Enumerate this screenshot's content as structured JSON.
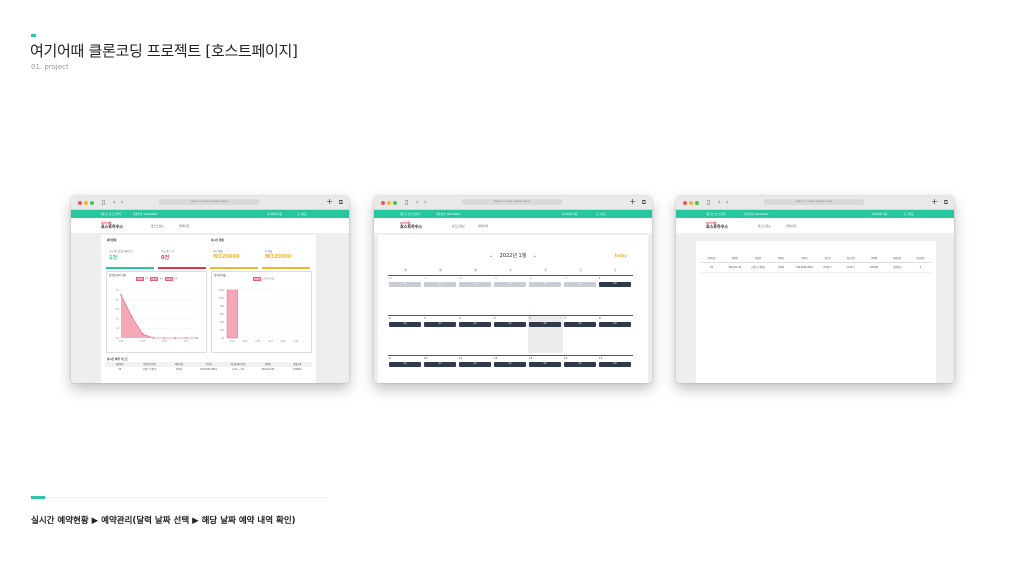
{
  "page": {
    "title": "여기어때 클론코딩 프로젝트 [호스트페이지]",
    "subtitle": "01. project",
    "caption": "실시간 예약현황 ▶ 예약관리(달력 날짜 선택 ▶ 해당 날짜 예약 내역 확인)"
  },
  "colors": {
    "accent": "#2ec4a6",
    "header_green": "#26c69f",
    "brand_red": "#e0344a",
    "today": "#f0b82e",
    "cal_button": "#2f3b4c"
  },
  "browser": {
    "back_icon": "chevron-left-icon",
    "forward_icon": "chevron-right-icon",
    "new_tab_label": "+",
    "url_placeholder": "Search or enter website name"
  },
  "site": {
    "logo_small": "여기어때",
    "logo_main": "호스트하우스",
    "header_left_1": "제트호 호스트센터",
    "header_left_2": "대표번호 1644-6007",
    "header_right_1": "여기어때 이용",
    "header_right_2": "로그아웃",
    "nav": [
      "호스트정보",
      "예약관리"
    ]
  },
  "dashboard": {
    "section_realtime": "예약현황",
    "section_sales": "실시간 매출",
    "cards": [
      {
        "label": "오늘 체크인할 예약건수",
        "value": "1건",
        "color": "#26c69f"
      },
      {
        "label": "오늘 취소 건",
        "value": "0건",
        "color": "#e0344a"
      },
      {
        "label": "지난 매출",
        "value": "₩120000",
        "color": "#f0b82e"
      },
      {
        "label": "총 매출",
        "value": "₩120000",
        "color": "#f0b82e"
      }
    ],
    "chart1_title": "일자별 예약 현황",
    "chart1_legend": [
      "예약",
      "취소",
      "전체"
    ],
    "chart2_title": "일자별 매출",
    "chart2_legend": "일자별 총 매출",
    "table_title": "실시간 예약 리스트",
    "table_headers": [
      "예약번호",
      "객실/투숙인원",
      "예약자명",
      "연락처",
      "체크인/체크아웃",
      "결제일",
      "결제금액"
    ],
    "table_row": [
      "35",
      "스위트 2 명(2)",
      "이박원",
      "010-6536-3061",
      "1/11 ~ 1/4",
      "2022-01-06",
      "120000"
    ]
  },
  "calendar": {
    "month": "2022년 1월",
    "prev_arrow": "◂",
    "next_arrow": "▸",
    "today_label": "Today",
    "weekdays": [
      "일",
      "월",
      "화",
      "수",
      "목",
      "금",
      "토"
    ],
    "button_label": "예약",
    "weeks": [
      [
        "26",
        "27",
        "28",
        "29",
        "30",
        "31",
        "1"
      ],
      [
        "2",
        "3",
        "4",
        "5",
        "6",
        "7",
        "8"
      ],
      [
        "9",
        "10",
        "11",
        "12",
        "13",
        "14",
        "15"
      ]
    ]
  },
  "reservation_detail": {
    "headers": [
      "예약번호",
      "예약일",
      "객실명",
      "예약자",
      "연락처",
      "체크인",
      "체크아웃",
      "결제액",
      "예약확인",
      "입금확인"
    ],
    "row": [
      "35",
      "2022-01-06",
      "스위트 2 명(2)",
      "이박원",
      "010-6536-3061",
      "15:00 ↑",
      "11:00 ↑",
      "120000",
      "확인완료",
      "0"
    ]
  },
  "chart_data": [
    {
      "type": "area",
      "title": "일자별 예약 현황",
      "series": [
        {
          "name": "예약",
          "values": [
            4.5,
            2.2,
            0.4,
            0,
            0,
            0,
            0,
            0
          ]
        }
      ],
      "x": [
        "1/11",
        "1/12",
        "1/13",
        "1/14",
        "1/15",
        "1/16",
        "1/17",
        "1/18"
      ],
      "ylim": [
        0,
        5
      ]
    },
    {
      "type": "bar",
      "title": "일자별 매출",
      "series": [
        {
          "name": "일자별 총 매출",
          "values": [
            120000,
            0,
            0,
            0,
            0,
            0
          ]
        }
      ],
      "categories": [
        "1/11",
        "1/12",
        "1/13",
        "1/14",
        "1/15",
        "1/16"
      ],
      "ylim": [
        0,
        120000
      ]
    }
  ]
}
